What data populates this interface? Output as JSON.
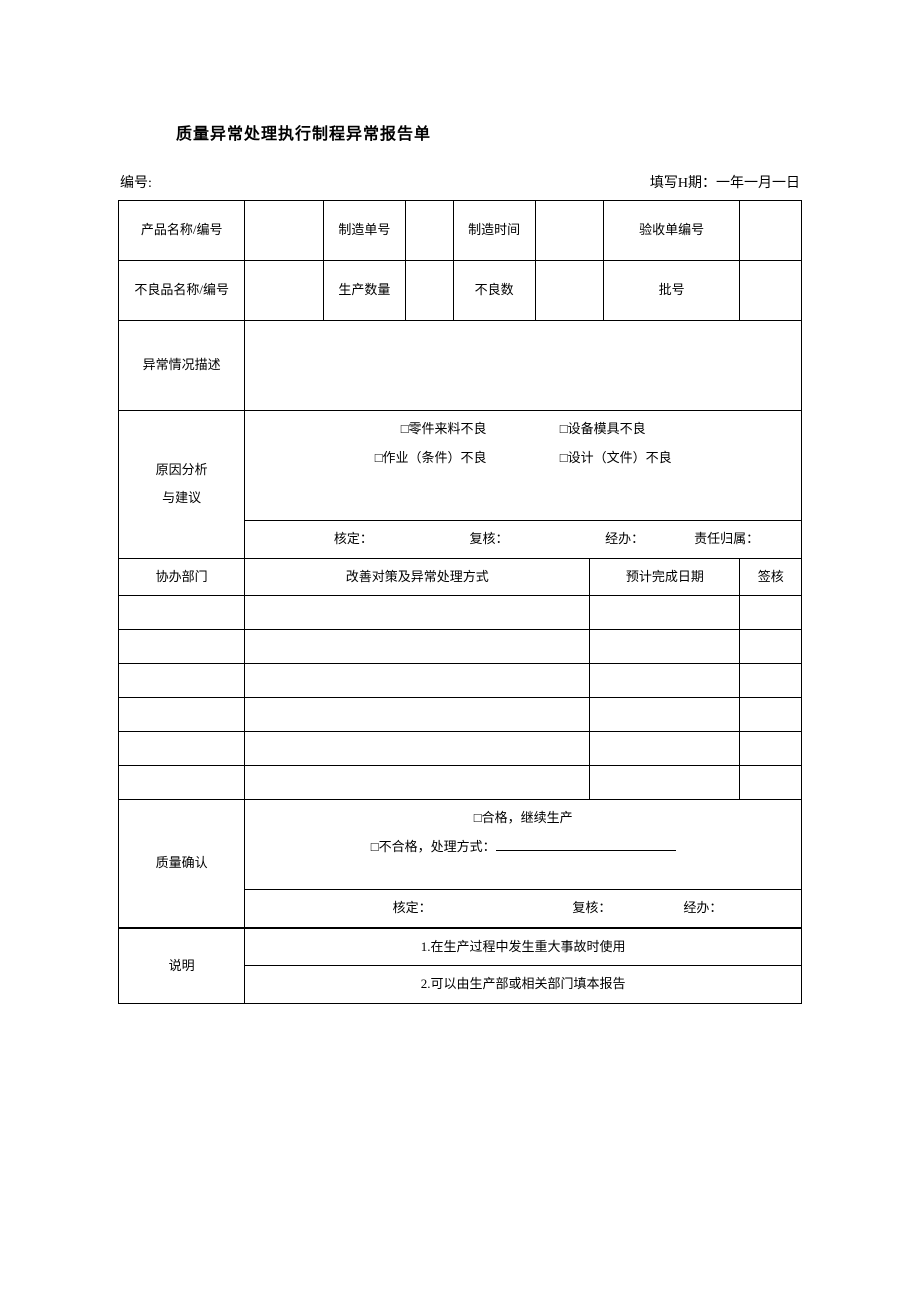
{
  "title": "质量异常处理执行制程异常报告单",
  "meta": {
    "number_label": "编号:",
    "date_label": "填写H期：一年一月一日"
  },
  "row1": {
    "c1": "产品名称/编号",
    "c3": "制造单号",
    "c5": "制造时间",
    "c7": "验收单编号"
  },
  "row2": {
    "c1": "不良品名称/编号",
    "c3": "生产数量",
    "c5": "不良数",
    "c7": "批号"
  },
  "row3": {
    "label": "异常情况描述"
  },
  "cause": {
    "label_l1": "原因分析",
    "label_l2": "与建议",
    "opt1": "□零件来料不良",
    "opt2": "□设备模具不良",
    "opt3": "□作业（条件）不良",
    "opt4": "□设计（文件）不良",
    "sig_approve": "核定：",
    "sig_review": "复核：",
    "sig_handle": "经办：",
    "sig_resp": "责任归属："
  },
  "action_header": {
    "dept": "协办部门",
    "measure": "改善对策及异常处理方式",
    "due": "预计完成日期",
    "sign": "签核"
  },
  "qc": {
    "label": "质量确认",
    "opt1": "□合格，继续生产",
    "opt2_prefix": "□不合格，处理方式：",
    "sig_approve": "核定：",
    "sig_review": "复核：",
    "sig_handle": "经办："
  },
  "notes": {
    "label": "说明",
    "n1": "1.在生产过程中发生重大事故时使用",
    "n2": "2.可以由生产部或相关部门填本报告"
  }
}
